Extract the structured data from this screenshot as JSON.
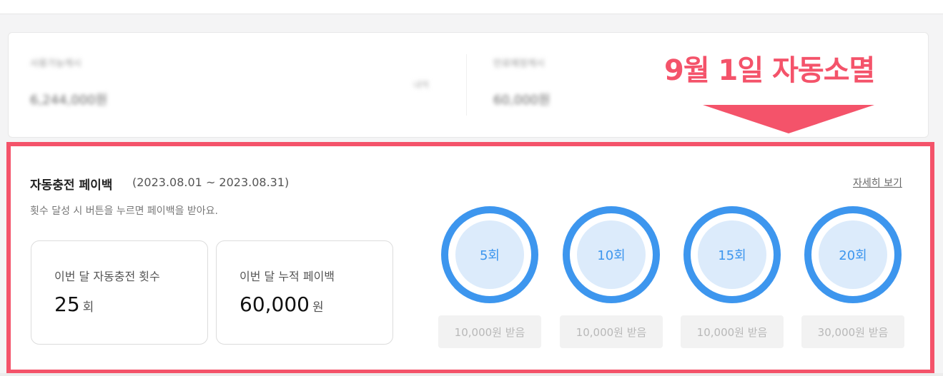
{
  "balance": {
    "left_label": "사용가능캐시",
    "left_amount": "6,244,000원",
    "middle_hint": "내역",
    "right_label": "만료예정캐시",
    "right_amount": "60,000원"
  },
  "annotation": {
    "expire_text": "9월 1일 자동소멸",
    "color": "#f4536a"
  },
  "payback": {
    "title": "자동충전 페이백",
    "period": "(2023.08.01 ~ 2023.08.31)",
    "description": "횟수 달성 시 버튼을 누르면 페이백을 받아요.",
    "more_link": "자세히 보기",
    "stats": [
      {
        "label": "이번 달 자동충전 횟수",
        "value": "25",
        "unit": "회"
      },
      {
        "label": "이번 달 누적 페이백",
        "value": "60,000",
        "unit": "원"
      }
    ],
    "tiers": [
      {
        "label": "5회",
        "claim": "10,000원 받음"
      },
      {
        "label": "10회",
        "claim": "10,000원 받음"
      },
      {
        "label": "15회",
        "claim": "10,000원 받음"
      },
      {
        "label": "20회",
        "claim": "30,000원 받음"
      }
    ],
    "accent_color": "#3d96ee"
  }
}
